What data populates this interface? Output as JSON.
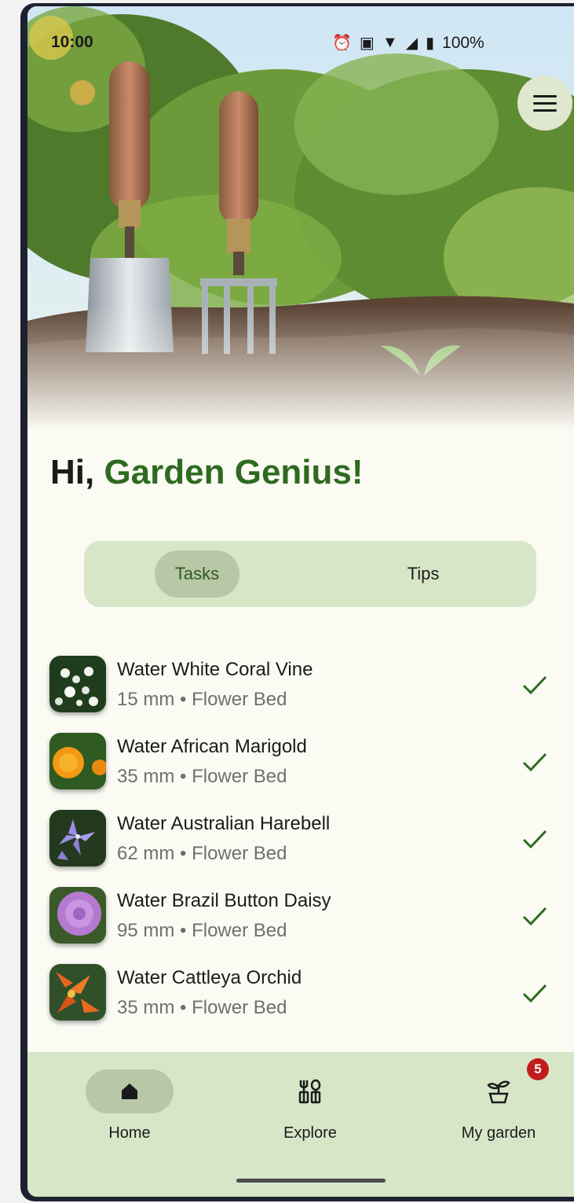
{
  "status_bar": {
    "time": "10:00",
    "battery": "100%",
    "icons": [
      "alarm-icon",
      "vibrate-icon",
      "wifi-icon",
      "signal-icon",
      "battery-icon"
    ]
  },
  "header": {
    "menu_icon": "menu-icon"
  },
  "greeting": {
    "prefix": "Hi, ",
    "name": "Garden Genius!"
  },
  "segmented": {
    "tabs": [
      {
        "label": "Tasks",
        "selected": true
      },
      {
        "label": "Tips",
        "selected": false
      }
    ]
  },
  "tasks": [
    {
      "title": "Water White Coral Vine",
      "subtitle": "15 mm • Flower Bed",
      "thumb": "white-coral-vine",
      "done": true
    },
    {
      "title": "Water African Marigold",
      "subtitle": "35 mm • Flower Bed",
      "thumb": "african-marigold",
      "done": true
    },
    {
      "title": "Water Australian Harebell",
      "subtitle": "62 mm • Flower Bed",
      "thumb": "australian-harebell",
      "done": true
    },
    {
      "title": "Water Brazil Button Daisy",
      "subtitle": "95 mm • Flower Bed",
      "thumb": "brazil-button-daisy",
      "done": true
    },
    {
      "title": "Water Cattleya Orchid",
      "subtitle": "35 mm • Flower Bed",
      "thumb": "cattleya-orchid",
      "done": true
    }
  ],
  "bottom_nav": {
    "items": [
      {
        "label": "Home",
        "icon": "home-icon",
        "selected": true
      },
      {
        "label": "Explore",
        "icon": "explore-icon",
        "selected": false
      },
      {
        "label": "My garden",
        "icon": "plant-icon",
        "selected": false,
        "badge": "5"
      }
    ]
  },
  "colors": {
    "accent": "#2e6b1f",
    "surface": "#fbfbf4",
    "container": "#d8e6c8",
    "selected": "#b8c7a6",
    "badge": "#c21b1b"
  }
}
